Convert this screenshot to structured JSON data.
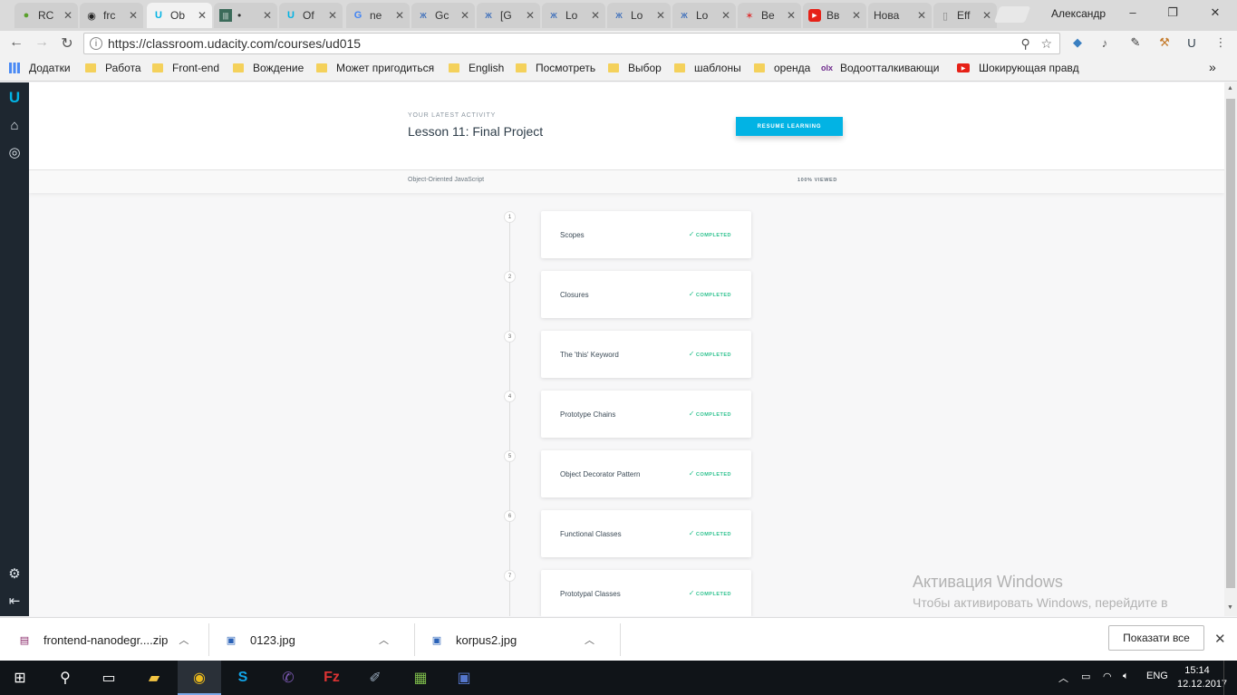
{
  "tabs": [
    {
      "title": "RC",
      "icon": "frog"
    },
    {
      "title": "frc",
      "icon": "github"
    },
    {
      "title": "Ob",
      "icon": "udacity",
      "active": true
    },
    {
      "title": "•",
      "icon": "meter"
    },
    {
      "title": "Of",
      "icon": "udacity"
    },
    {
      "title": "ne",
      "icon": "google"
    },
    {
      "title": "Gc",
      "icon": "butterfly"
    },
    {
      "title": "[G",
      "icon": "butterfly"
    },
    {
      "title": "Lo",
      "icon": "butterfly"
    },
    {
      "title": "Lo",
      "icon": "butterfly"
    },
    {
      "title": "Lo",
      "icon": "butterfly"
    },
    {
      "title": "Be",
      "icon": "antenna"
    },
    {
      "title": "Bв",
      "icon": "youtube"
    },
    {
      "title": "Нова",
      "icon": "none"
    },
    {
      "title": "Eff",
      "icon": "doc"
    }
  ],
  "profile_name": "Александр",
  "window_controls": {
    "minimize": "–",
    "restore": "❐",
    "close": "✕"
  },
  "url": "https://classroom.udacity.com/courses/ud015",
  "bookmarks": [
    {
      "label": "Додатки",
      "type": "apps"
    },
    {
      "label": "Работа",
      "type": "folder"
    },
    {
      "label": "Front-end",
      "type": "folder"
    },
    {
      "label": "Вождение",
      "type": "folder"
    },
    {
      "label": "Может пригодиться",
      "type": "folder"
    },
    {
      "label": "English",
      "type": "folder"
    },
    {
      "label": "Посмотреть",
      "type": "folder"
    },
    {
      "label": "Выбор",
      "type": "folder"
    },
    {
      "label": "шаблоны",
      "type": "folder"
    },
    {
      "label": "оренда",
      "type": "folder"
    },
    {
      "label": "Водоотталкивающи",
      "type": "olx"
    },
    {
      "label": "Шокирующая правд",
      "type": "youtube"
    }
  ],
  "bookmarks_more": "»",
  "latest_activity": {
    "label": "YOUR LATEST ACTIVITY",
    "title": "Lesson 11: Final Project",
    "button": "RESUME LEARNING"
  },
  "course": {
    "name": "Object-Oriented JavaScript",
    "viewed": "100% VIEWED"
  },
  "lessons": [
    {
      "num": "1",
      "title": "Scopes",
      "status": "COMPLETED"
    },
    {
      "num": "2",
      "title": "Closures",
      "status": "COMPLETED"
    },
    {
      "num": "3",
      "title": "The 'this' Keyword",
      "status": "COMPLETED"
    },
    {
      "num": "4",
      "title": "Prototype Chains",
      "status": "COMPLETED"
    },
    {
      "num": "5",
      "title": "Object Decorator Pattern",
      "status": "COMPLETED"
    },
    {
      "num": "6",
      "title": "Functional Classes",
      "status": "COMPLETED"
    },
    {
      "num": "7",
      "title": "Prototypal Classes",
      "status": "COMPLETED"
    }
  ],
  "watermark": {
    "title": "Активация Windows",
    "subtitle": "Чтобы активировать Windows, перейдите в раздел \"Параметры\"."
  },
  "downloads": [
    {
      "name": "frontend-nanodegr....zip",
      "icon": "archive"
    },
    {
      "name": "0123.jpg",
      "icon": "image"
    },
    {
      "name": "korpus2.jpg",
      "icon": "image"
    }
  ],
  "show_all": "Показати все",
  "taskbar": {
    "lang": "ENG",
    "time": "15:14",
    "date": "12.12.2017"
  },
  "colors": {
    "accent": "#02b3e4",
    "completed": "#2ec28f",
    "rail": "#1e2730"
  }
}
